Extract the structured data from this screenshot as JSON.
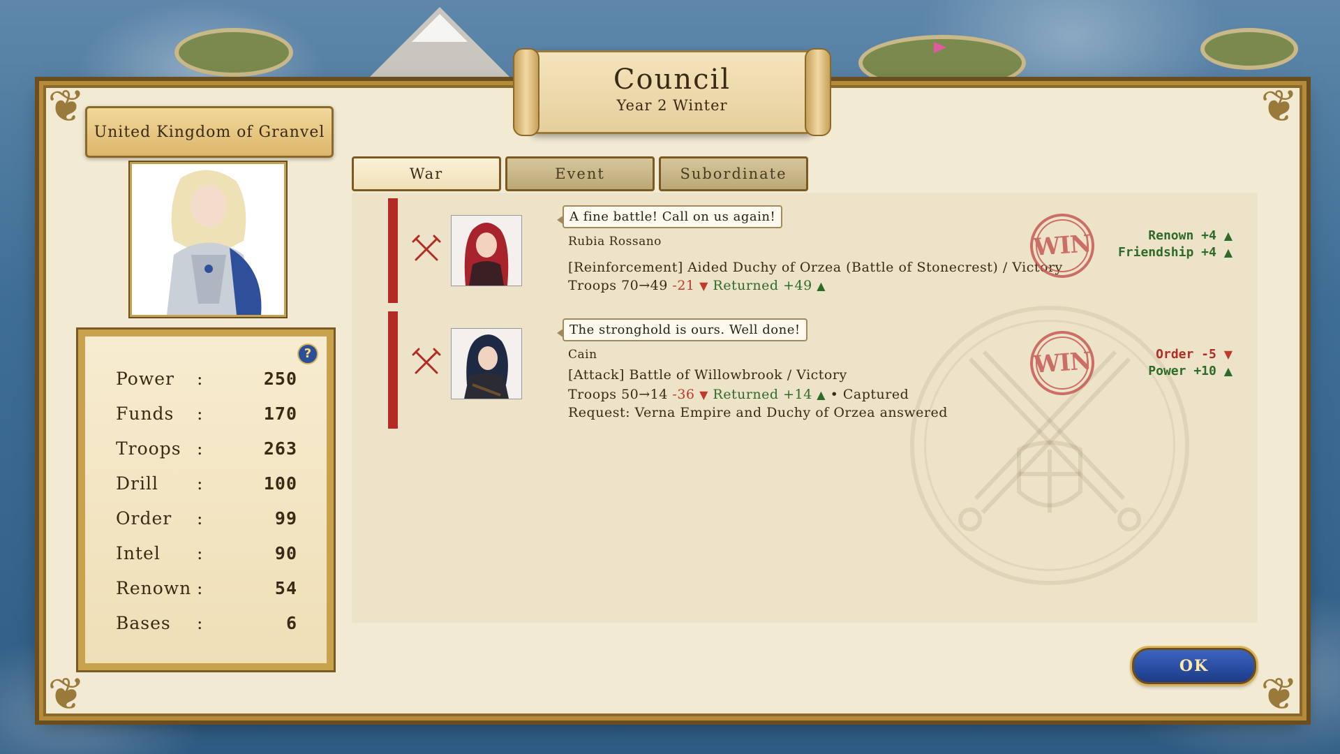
{
  "header": {
    "title": "Council",
    "subtitle": "Year 2 Winter"
  },
  "kingdom": {
    "name": "United Kingdom of Granvel"
  },
  "stats": [
    {
      "label": "Power",
      "value": "250"
    },
    {
      "label": "Funds",
      "value": "170"
    },
    {
      "label": "Troops",
      "value": "263"
    },
    {
      "label": "Drill",
      "value": "100"
    },
    {
      "label": "Order",
      "value": "99"
    },
    {
      "label": "Intel",
      "value": "90"
    },
    {
      "label": "Renown",
      "value": "54"
    },
    {
      "label": "Bases",
      "value": "6"
    }
  ],
  "stats_colon": ":",
  "help_icon_glyph": "?",
  "tabs": [
    {
      "label": "War",
      "active": true
    },
    {
      "label": "Event",
      "active": false
    },
    {
      "label": "Subordinate",
      "active": false
    }
  ],
  "reports": [
    {
      "quote": "A fine battle! Call on us again!",
      "name": "Rubia Rossano",
      "description": "[Reinforcement] Aided Duchy of Orzea (Battle of Stonecrest) / Victory",
      "troops_text": "Troops 70→49",
      "troops_delta": "-21",
      "returned": "Returned +49",
      "extra": "",
      "request": "",
      "stamp": "WIN",
      "effects": [
        {
          "text": "Renown +4",
          "direction": "up"
        },
        {
          "text": "Friendship +4",
          "direction": "up"
        }
      ]
    },
    {
      "quote": "The stronghold is ours. Well done!",
      "name": "Cain",
      "description": "[Attack] Battle of Willowbrook / Victory",
      "troops_text": "Troops 50→14",
      "troops_delta": "-36",
      "returned": "Returned +14",
      "extra": "• Captured",
      "request": "Request: Verna Empire and Duchy of Orzea answered",
      "stamp": "WIN",
      "effects": [
        {
          "text": "Order -5",
          "direction": "down"
        },
        {
          "text": "Power +10",
          "direction": "up"
        }
      ]
    }
  ],
  "ok_button": {
    "label": "OK"
  },
  "colors": {
    "accent_red": "#b42b25",
    "positive": "#2e6b2a",
    "negative": "#c0392b",
    "gold": "#c9a24e",
    "button_blue": "#1d3b87"
  }
}
